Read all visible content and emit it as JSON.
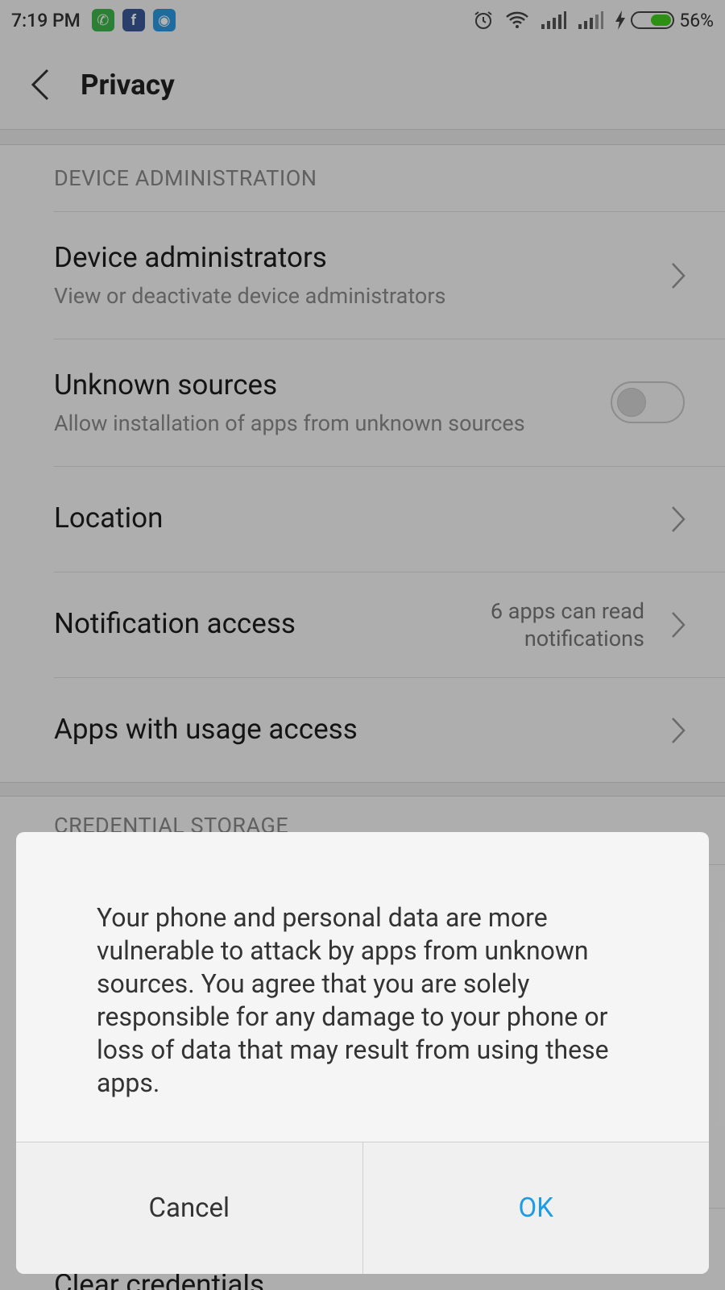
{
  "status_bar": {
    "time": "7:19 PM",
    "battery_percent": "56%",
    "battery_level": 0.56,
    "notification_apps": [
      "whatsapp-icon",
      "facebook-icon",
      "messenger-icon"
    ]
  },
  "header": {
    "title": "Privacy"
  },
  "sections": {
    "device_admin": {
      "title": "DEVICE ADMINISTRATION",
      "rows": [
        {
          "label": "Device administrators",
          "sub": "View or deactivate device administrators"
        },
        {
          "label": "Unknown sources",
          "sub": "Allow installation of apps from unknown sources",
          "toggle_on": false
        },
        {
          "label": "Location"
        },
        {
          "label": "Notification access",
          "value_line1": "6 apps can read",
          "value_line2": "notifications"
        },
        {
          "label": "Apps with usage access"
        }
      ]
    },
    "credential": {
      "title": "CREDENTIAL STORAGE",
      "last_row_label": "Clear credentials"
    }
  },
  "dialog": {
    "message": "Your phone and personal data are more vulnerable to attack by apps from unknown sources. You agree that you are solely responsible for any damage to your phone or loss of data that may result from using these apps.",
    "cancel_label": "Cancel",
    "ok_label": "OK",
    "ok_color": "#1c9ce7"
  }
}
